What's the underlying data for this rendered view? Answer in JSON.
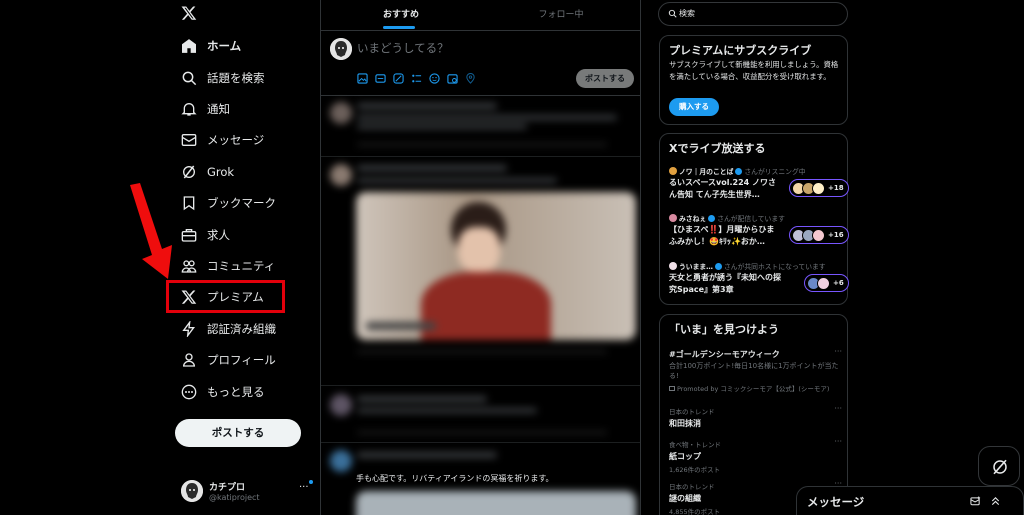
{
  "nav": {
    "items": [
      {
        "label": "ホーム",
        "icon": "home-icon"
      },
      {
        "label": "話題を検索",
        "icon": "search-icon"
      },
      {
        "label": "通知",
        "icon": "bell-icon"
      },
      {
        "label": "メッセージ",
        "icon": "mail-icon"
      },
      {
        "label": "Grok",
        "icon": "grok-icon"
      },
      {
        "label": "ブックマーク",
        "icon": "bookmark-icon"
      },
      {
        "label": "求人",
        "icon": "briefcase-icon"
      },
      {
        "label": "コミュニティ",
        "icon": "community-icon"
      },
      {
        "label": "プレミアム",
        "icon": "x-logo-icon"
      },
      {
        "label": "認証済み組織",
        "icon": "lightning-icon"
      },
      {
        "label": "プロフィール",
        "icon": "person-icon"
      },
      {
        "label": "もっと見る",
        "icon": "more-circle-icon"
      }
    ],
    "post_button": "ポストする",
    "account": {
      "name": "カチプロ",
      "handle": "@katiproject",
      "more": "···"
    }
  },
  "feed": {
    "tabs": [
      "おすすめ",
      "フォロー中"
    ],
    "composer_placeholder": "いまどうしてる？",
    "composer_post": "ポストする",
    "visible_tweet_text": "手も心配です。リバティアイランドの冥福を祈ります。"
  },
  "right": {
    "search_placeholder": "検索",
    "subscribe": {
      "title": "プレミアムにサブスクライブ",
      "body": "サブスクライブして新機能を利用しましょう。資格を満たしている場合、収益配分を受け取れます。",
      "button": "購入する"
    },
    "live": {
      "title": "Xでライブ放送する",
      "items": [
        {
          "host": "ノワ｜月のことば",
          "status": "さんがリスニング中",
          "title": "るいスペースvol.224 ノワさん告知 てん子先生世界…",
          "count": "+18"
        },
        {
          "host": "みさねぇ",
          "status": "さんが配信しています",
          "title": "【ひまスペ‼️】月曜からひまふみかし！🤩ｷﾘｯ✨おか…",
          "count": "+16"
        },
        {
          "host": "ういまま…",
          "status": "さんが共同ホストになっています",
          "title": "天女と勇者が誘う『未知への探究Space』第3章",
          "count": "+6"
        }
      ]
    },
    "trends": {
      "title": "「いま」を見つけよう",
      "items": [
        {
          "context": "",
          "name": "#ゴールデンシーモアウィーク",
          "desc": "合計100万ポイント!毎日10名様に1万ポイントが当たる!",
          "promo": "Promoted by コミックシーモア【公式】(シーモア)",
          "count": ""
        },
        {
          "context": "日本のトレンド",
          "name": "和田抹消",
          "desc": "",
          "promo": "",
          "count": ""
        },
        {
          "context": "食べ物・トレンド",
          "name": "紙コップ",
          "desc": "",
          "promo": "",
          "count": "1,626件のポスト"
        },
        {
          "context": "日本のトレンド",
          "name": "謎の組織",
          "desc": "",
          "promo": "",
          "count": "4,855件のポスト"
        }
      ]
    }
  },
  "messages": {
    "title": "メッセージ"
  },
  "colors": {
    "accent": "#1d9bf0",
    "highlight": "#e3000b",
    "background": "#000000"
  }
}
